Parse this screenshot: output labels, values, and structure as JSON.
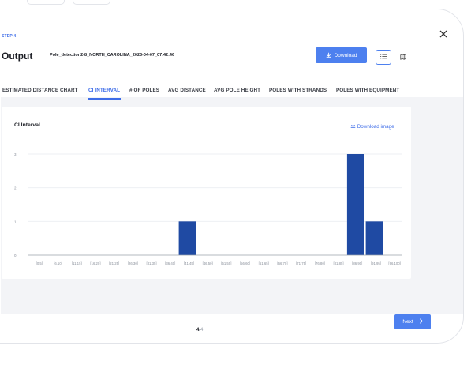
{
  "step": {
    "label": "STEP 4"
  },
  "header": {
    "title": "Output",
    "run_name": "Pole_detection2-8_NORTH_CAROLINA_2023-04-07_07:42:46",
    "download_label": "Download",
    "download_icon": "download-icon",
    "close_icon": "close-icon"
  },
  "view_toggle": {
    "list_icon": "list-view-icon",
    "map_icon": "map-view-icon",
    "active": "list"
  },
  "tabs": [
    {
      "label": "ESTIMATED DISTANCE CHART"
    },
    {
      "label": "CI INTERVAL"
    },
    {
      "label": "# OF POLES"
    },
    {
      "label": "AVG DISTANCE"
    },
    {
      "label": "AVG POLE HEIGHT"
    },
    {
      "label": "POLES WITH STRANDS"
    },
    {
      "label": "POLES WITH EQUIPMENT"
    }
  ],
  "active_tab": "CI INTERVAL",
  "card": {
    "title": "CI Interval",
    "download_image_label": "Download image"
  },
  "chart_data": {
    "type": "bar",
    "title": "CI Interval",
    "xlabel": "",
    "ylabel": "",
    "ylim": [
      0,
      3.5
    ],
    "yticks": [
      0,
      1,
      2,
      3
    ],
    "grid": true,
    "categories": [
      "[0,5]",
      "[6,10]",
      "[11,15]",
      "[16,20]",
      "[21,25]",
      "[26,30]",
      "[31,35]",
      "[36,40]",
      "[41,45]",
      "[46,50]",
      "[51,55]",
      "[56,60]",
      "[61,65]",
      "[66,70]",
      "[71,75]",
      "[76,80]",
      "[81,85]",
      "[86,90]",
      "[91,95]",
      "[96,100]"
    ],
    "values": [
      0,
      0,
      0,
      0,
      0,
      0,
      0,
      0,
      1,
      0,
      0,
      0,
      0,
      0,
      0,
      0,
      0,
      3,
      1,
      0
    ],
    "bar_color": "#1f4aa3"
  },
  "pagination": {
    "current": "4",
    "total": "/4"
  },
  "footer": {
    "next_label": "Next"
  },
  "colors": {
    "accent": "#4d80ef",
    "bar": "#1f4aa3",
    "panel_bg": "#f3f4f7"
  }
}
